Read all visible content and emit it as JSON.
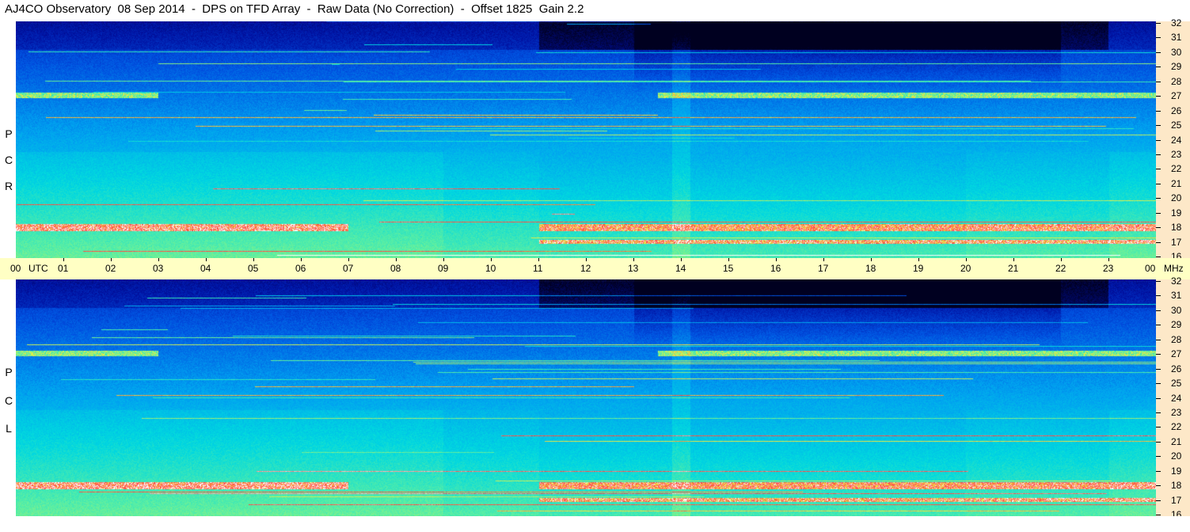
{
  "title": "AJ4CO Observatory  08 Sep 2014  -  DPS on TFD Array  -  Raw Data (No Correction)  -  Offset 1825  Gain 2.2",
  "panels": [
    {
      "label_letters": [
        "P",
        "C",
        "R"
      ],
      "name": "rcp"
    },
    {
      "label_letters": [
        "P",
        "C",
        "L"
      ],
      "name": "lcp"
    }
  ],
  "time_axis": {
    "first_label": "00",
    "utc_label": "UTC",
    "labels": [
      "01",
      "02",
      "03",
      "04",
      "05",
      "06",
      "07",
      "08",
      "09",
      "10",
      "11",
      "12",
      "13",
      "14",
      "15",
      "16",
      "17",
      "18",
      "19",
      "20",
      "21",
      "22",
      "23"
    ],
    "last_label": "00",
    "unit_label": "MHz"
  },
  "freq_scale": {
    "labels": [
      "32",
      "31",
      "30",
      "29",
      "28",
      "27",
      "26",
      "25",
      "24",
      "23",
      "22",
      "21",
      "20",
      "19",
      "18",
      "17",
      "16"
    ]
  },
  "chart_data": {
    "type": "heatmap",
    "x_unit": "UTC hour",
    "xlim": [
      0,
      24
    ],
    "y_unit": "MHz",
    "ylim": [
      16,
      32
    ],
    "colormap": [
      "#000020",
      "#0010a0",
      "#0050e0",
      "#00a0f0",
      "#00d8e0",
      "#60f0a0",
      "#f0f040",
      "#ff4040",
      "#ffffff"
    ],
    "series": [
      {
        "name": "RCP"
      },
      {
        "name": "LCP"
      }
    ]
  }
}
